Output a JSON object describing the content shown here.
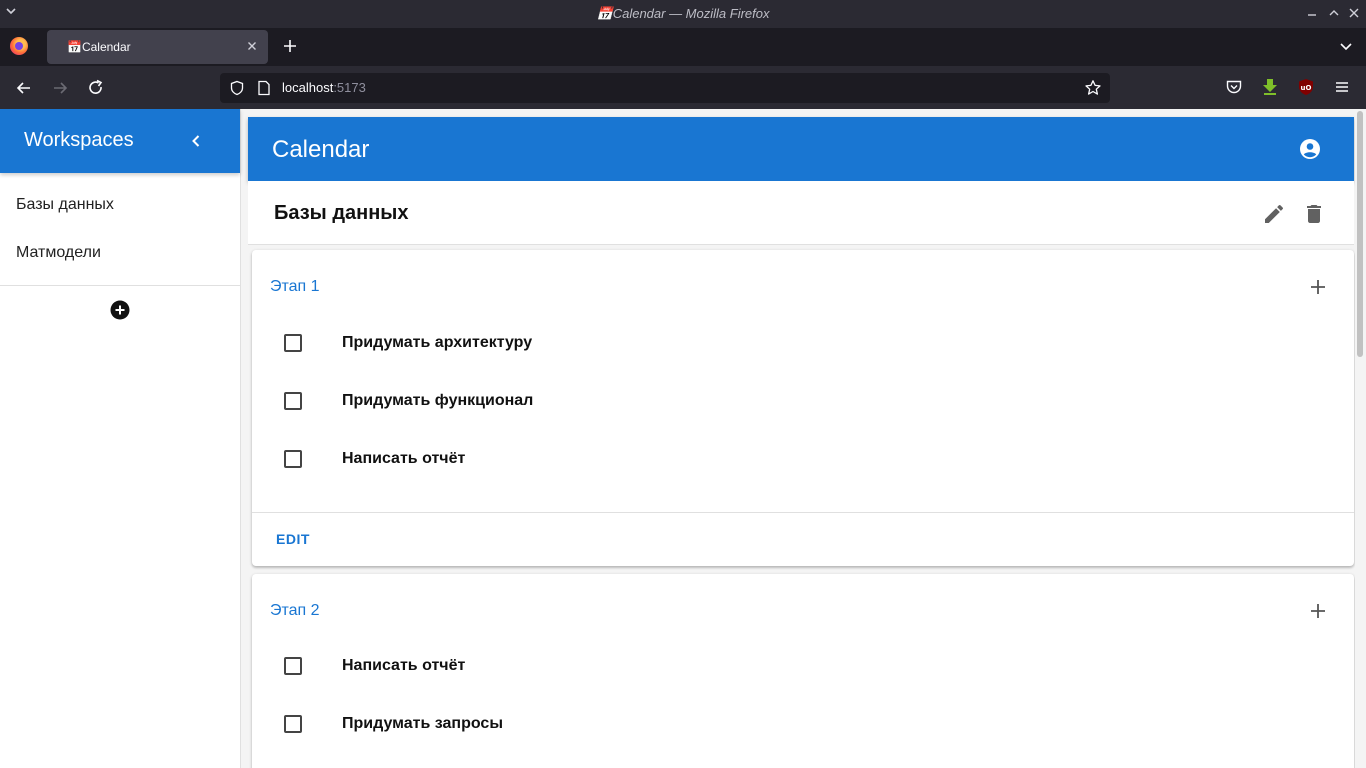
{
  "window": {
    "title": "📅Calendar — Mozilla Firefox"
  },
  "tabs": [
    {
      "label": "📅Calendar",
      "active": true
    }
  ],
  "urlbar": {
    "host": "localhost",
    "port": ":5173"
  },
  "drawer": {
    "title": "Workspaces",
    "workspaces": [
      {
        "label": "Базы данных"
      },
      {
        "label": "Матмодели"
      }
    ]
  },
  "appbar": {
    "title": "Calendar"
  },
  "workspace": {
    "title": "Базы данных"
  },
  "stages": [
    {
      "title": "Этап 1",
      "tasks": [
        {
          "label": "Придумать архитектуру",
          "checked": false
        },
        {
          "label": "Придумать функционал",
          "checked": false
        },
        {
          "label": "Написать отчёт",
          "checked": false
        }
      ],
      "action_label": "EDIT"
    },
    {
      "title": "Этап 2",
      "tasks": [
        {
          "label": "Написать отчёт",
          "checked": false
        },
        {
          "label": "Придумать запросы",
          "checked": false
        }
      ]
    }
  ],
  "colors": {
    "primary": "#1976d2",
    "browser_chrome": "#2b2a33",
    "tab_strip": "#1c1b22"
  },
  "icons": {
    "collapse": "chevron-left-icon",
    "add_workspace": "add-circle-icon",
    "account": "account-circle-icon",
    "edit": "pencil-icon",
    "delete": "trash-icon",
    "add_task": "plus-icon"
  }
}
